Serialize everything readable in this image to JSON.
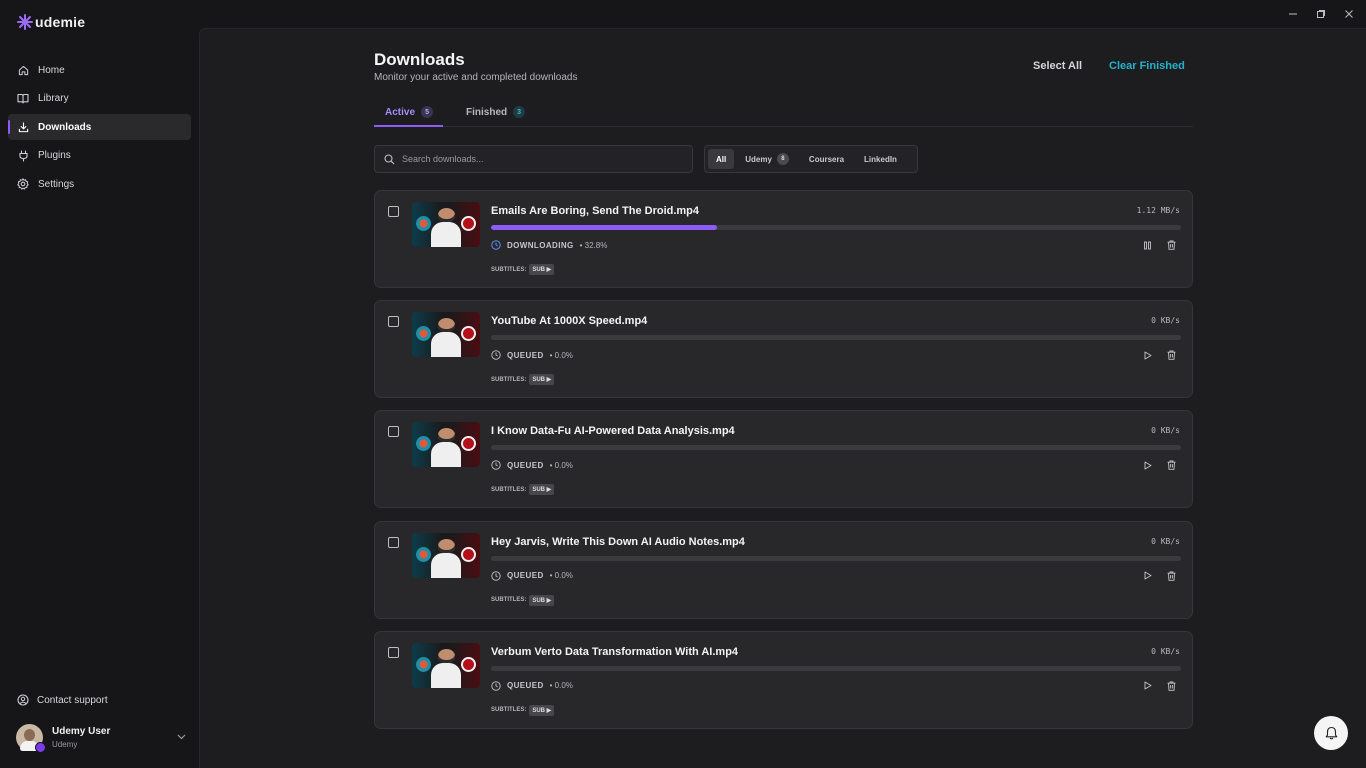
{
  "app": {
    "name": "udemie",
    "brand_color": "#8b5cf6",
    "accent_color": "#22b3c9"
  },
  "sidebar": {
    "items": [
      {
        "label": "Home",
        "icon": "home-icon"
      },
      {
        "label": "Library",
        "icon": "book-icon"
      },
      {
        "label": "Downloads",
        "icon": "download-icon",
        "active": true
      },
      {
        "label": "Plugins",
        "icon": "plug-icon"
      },
      {
        "label": "Settings",
        "icon": "gear-icon"
      }
    ],
    "support_label": "Contact support",
    "user": {
      "name": "Udemy User",
      "subtitle": "Udemy"
    }
  },
  "header": {
    "title": "Downloads",
    "subtitle": "Monitor your active and completed downloads",
    "select_all": "Select All",
    "clear_finished": "Clear Finished"
  },
  "tabs": [
    {
      "label": "Active",
      "count": "5"
    },
    {
      "label": "Finished",
      "count": "3"
    }
  ],
  "search": {
    "placeholder": "Search downloads..."
  },
  "filters": [
    {
      "label": "All",
      "active": true
    },
    {
      "label": "Udemy",
      "count": "8"
    },
    {
      "label": "Coursera"
    },
    {
      "label": "LinkedIn"
    }
  ],
  "downloads": [
    {
      "filename": "Emails Are Boring, Send The Droid.mp4",
      "speed": "1.12 MB/s",
      "status": "DOWNLOADING",
      "percent": "• 32.8%",
      "progress": 0.328,
      "subtitles_label": "SUBTITLES:",
      "sub_tag": "SUB ▶"
    },
    {
      "filename": "YouTube At 1000X Speed.mp4",
      "speed": "0 KB/s",
      "status": "QUEUED",
      "percent": "• 0.0%",
      "progress": 0,
      "subtitles_label": "SUBTITLES:",
      "sub_tag": "SUB ▶"
    },
    {
      "filename": "I Know Data-Fu AI-Powered Data Analysis.mp4",
      "speed": "0 KB/s",
      "status": "QUEUED",
      "percent": "• 0.0%",
      "progress": 0,
      "subtitles_label": "SUBTITLES:",
      "sub_tag": "SUB ▶"
    },
    {
      "filename": "Hey Jarvis, Write This Down AI Audio Notes.mp4",
      "speed": "0 KB/s",
      "status": "QUEUED",
      "percent": "• 0.0%",
      "progress": 0,
      "subtitles_label": "SUBTITLES:",
      "sub_tag": "SUB ▶"
    },
    {
      "filename": "Verbum Verto Data Transformation With AI.mp4",
      "speed": "0 KB/s",
      "status": "QUEUED",
      "percent": "• 0.0%",
      "progress": 0,
      "subtitles_label": "SUBTITLES:",
      "sub_tag": "SUB ▶"
    }
  ]
}
